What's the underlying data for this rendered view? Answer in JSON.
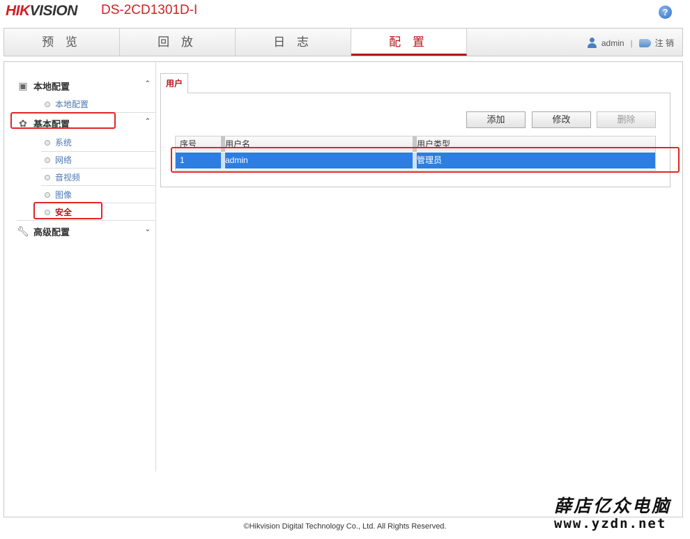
{
  "header": {
    "logo_red": "HIK",
    "logo_dark": "VISION",
    "model": "DS-2CD1301D-I",
    "help_icon": "?"
  },
  "nav": {
    "tabs": [
      {
        "label": "预 览"
      },
      {
        "label": "回 放"
      },
      {
        "label": "日 志"
      },
      {
        "label": "配 置"
      }
    ],
    "active_tab": "配 置",
    "username": "admin",
    "separator": "|",
    "logout": "注 销"
  },
  "sidebar": {
    "sections": [
      {
        "label": "本地配置",
        "icon": "monitor-icon",
        "caret": "⌃",
        "items": [
          "本地配置"
        ]
      },
      {
        "label": "基本配置",
        "icon": "gear-icon",
        "caret": "⌃",
        "items": [
          "系统",
          "网络",
          "音视频",
          "图像",
          "安全"
        ]
      },
      {
        "label": "高级配置",
        "icon": "wrench-icon",
        "caret": "⌄",
        "items": []
      }
    ],
    "active_item": "安全"
  },
  "content": {
    "tab_label": "用户",
    "buttons": {
      "add": "添加",
      "modify": "修改",
      "delete": "删除"
    },
    "table": {
      "columns": [
        "序号",
        "用户名",
        "用户类型"
      ],
      "rows": [
        {
          "index": "1",
          "username": "admin",
          "type": "管理员"
        }
      ]
    }
  },
  "footer": "©Hikvision Digital Technology Co., Ltd. All Rights Reserved.",
  "watermark": {
    "line1": "薛店亿众电脑",
    "line2": "www.yzdn.net"
  },
  "colors": {
    "brand_red": "#d21f26",
    "active_red": "#b5151b",
    "selection_blue": "#2d7ee0",
    "annotation_red": "#e02525"
  }
}
